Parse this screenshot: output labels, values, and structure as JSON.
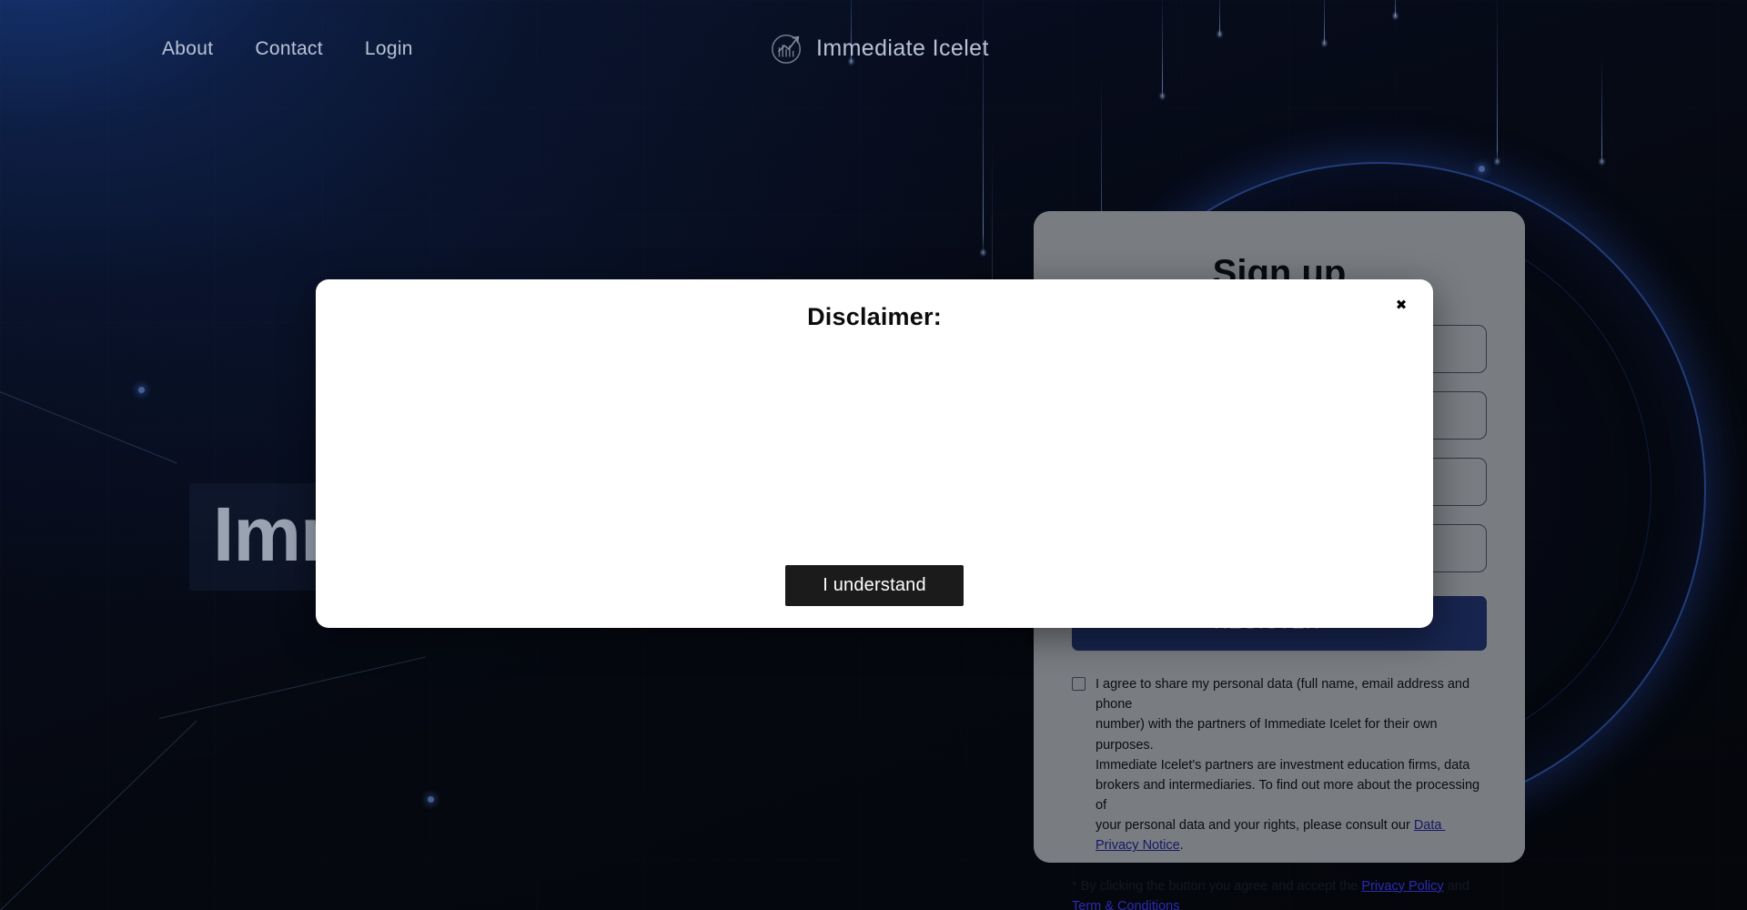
{
  "colors": {
    "page_bg": "#05070d",
    "accent_blue": "#2a4189",
    "glow_blue": "#3a68cd",
    "panel_bg": "#d8dde6",
    "modal_bg": "#ffffff",
    "link": "#2b2bb5",
    "nav_text": "#b9c3d6",
    "hero_text": "#9aa3b2",
    "understand_btn_bg": "#1b1b1b"
  },
  "nav": {
    "links": [
      {
        "label": "About"
      },
      {
        "label": "Contact"
      },
      {
        "label": "Login"
      }
    ],
    "brand": {
      "name": "Immediate Icelet",
      "logo_icon": "chart-growth-circle-icon"
    }
  },
  "hero": {
    "title": "Imm"
  },
  "signup": {
    "title": "Sign up",
    "fields": [
      {
        "name": "first-name",
        "value": "",
        "placeholder": ""
      },
      {
        "name": "last-name",
        "value": "",
        "placeholder": ""
      },
      {
        "name": "email",
        "value": "",
        "placeholder": ""
      },
      {
        "name": "phone",
        "value": "",
        "placeholder": ""
      }
    ],
    "register_label": "REGISTER>>",
    "consent": {
      "checked": false,
      "text": "I agree to share my personal data (full name, email address and phone\nnumber) with the partners of Immediate Icelet for their own purposes.\nImmediate Icelet's partners are investment education firms, data\nbrokers and intermediaries. To find out more about the processing of\nyour personal data and your rights, please consult our ",
      "link_label": "Data Privacy Notice",
      "text_end": "."
    },
    "terms": {
      "prefix": "* By clicking the button you agree and accept the ",
      "link1": "Privacy Policy",
      "middle": " and ",
      "link2": "Term & Conditions"
    }
  },
  "modal": {
    "title": "Disclaimer:",
    "body": "",
    "close_label": "✖",
    "understand_label": "I understand"
  }
}
